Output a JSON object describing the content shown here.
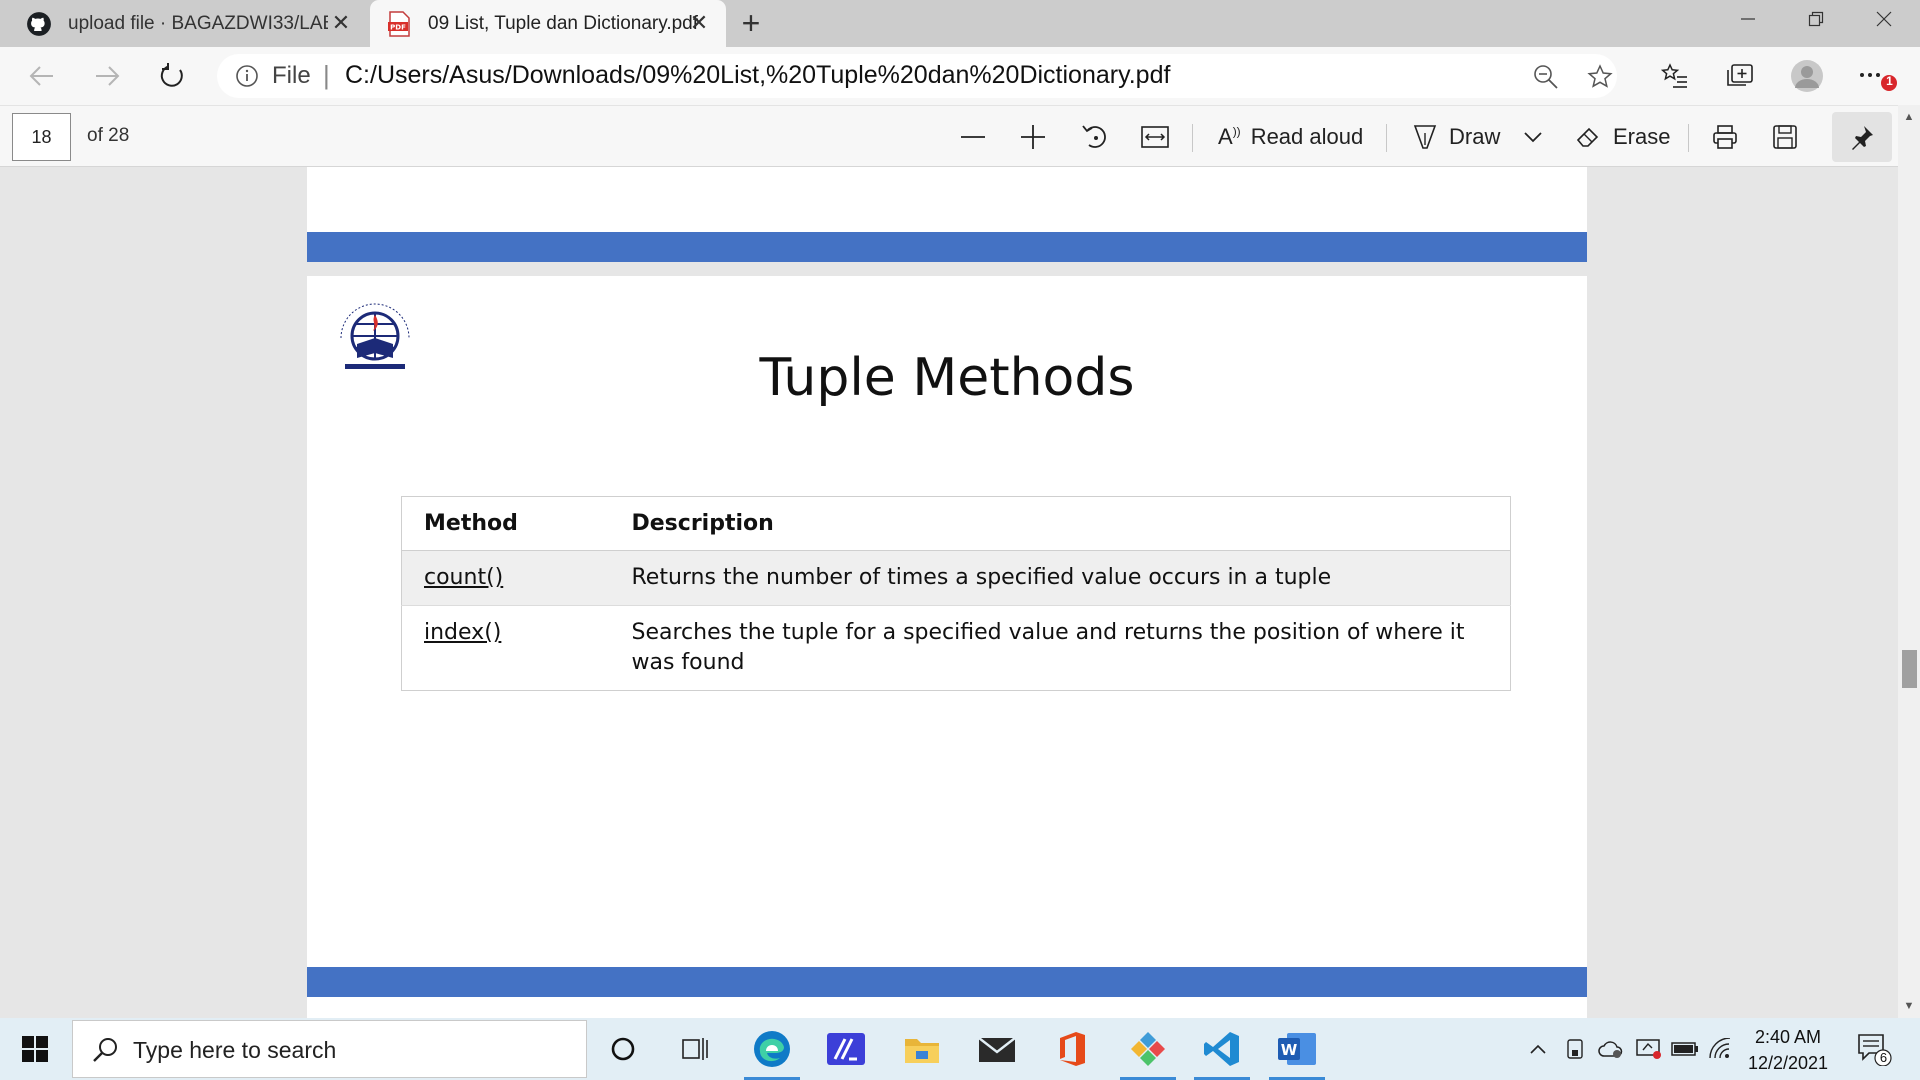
{
  "browser": {
    "tabs": [
      {
        "title": "upload file · BAGAZDWI33/LAB3",
        "icon": "github-icon"
      },
      {
        "title": "09 List, Tuple dan Dictionary.pdf",
        "icon": "pdf-icon"
      }
    ],
    "address": {
      "scheme_label": "File",
      "url": "C:/Users/Asus/Downloads/09%20List,%20Tuple%20dan%20Dictionary.pdf"
    },
    "notification_badge": "1"
  },
  "pdf_toolbar": {
    "page_number": "18",
    "page_total": "of 28",
    "read_aloud": "Read aloud",
    "draw": "Draw",
    "erase": "Erase"
  },
  "slide": {
    "title": "Tuple Methods",
    "table": {
      "headers": [
        "Method",
        "Description"
      ],
      "rows": [
        {
          "method": "count()",
          "description": "Returns the number of times a specified value occurs in a tuple"
        },
        {
          "method": "index()",
          "description": "Searches the tuple for a specified value and returns the position of where it was found"
        }
      ]
    },
    "accent_color": "#4472c4"
  },
  "taskbar": {
    "search_placeholder": "Type here to search",
    "time": "2:40 AM",
    "date": "12/2/2021",
    "notification_count": "6"
  }
}
